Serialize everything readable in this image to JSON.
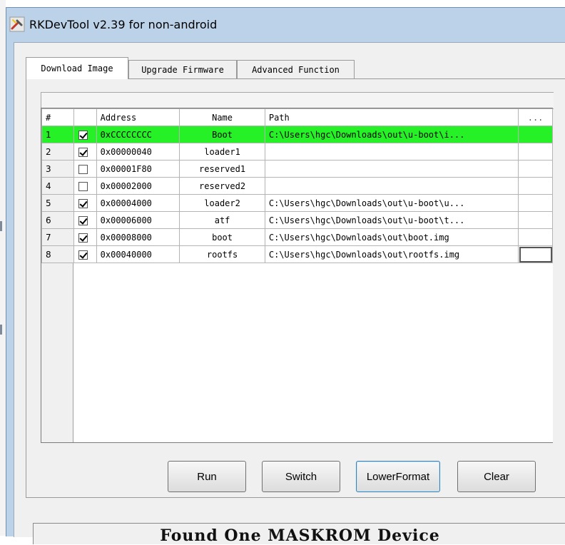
{
  "window": {
    "title": "RKDevTool v2.39 for non-android"
  },
  "tabs": [
    {
      "label": "Download Image",
      "active": true
    },
    {
      "label": "Upgrade Firmware",
      "active": false
    },
    {
      "label": "Advanced Function",
      "active": false
    }
  ],
  "table": {
    "headers": {
      "index": "#",
      "check": "",
      "address": "Address",
      "name": "Name",
      "path": "Path",
      "more": "..."
    },
    "rows": [
      {
        "index": "1",
        "checked": true,
        "address": "0xCCCCCCCC",
        "name": "Boot",
        "path": "C:\\Users\\hgc\\Downloads\\out\\u-boot\\i...",
        "selected": true
      },
      {
        "index": "2",
        "checked": true,
        "address": "0x00000040",
        "name": "loader1",
        "path": ""
      },
      {
        "index": "3",
        "checked": false,
        "address": "0x00001F80",
        "name": "reserved1",
        "path": ""
      },
      {
        "index": "4",
        "checked": false,
        "address": "0x00002000",
        "name": "reserved2",
        "path": ""
      },
      {
        "index": "5",
        "checked": true,
        "address": "0x00004000",
        "name": "loader2",
        "path": "C:\\Users\\hgc\\Downloads\\out\\u-boot\\u..."
      },
      {
        "index": "6",
        "checked": true,
        "address": "0x00006000",
        "name": "atf",
        "path": "C:\\Users\\hgc\\Downloads\\out\\u-boot\\t..."
      },
      {
        "index": "7",
        "checked": true,
        "address": "0x00008000",
        "name": "boot",
        "path": "C:\\Users\\hgc\\Downloads\\out\\boot.img"
      },
      {
        "index": "8",
        "checked": true,
        "address": "0x00040000",
        "name": "rootfs",
        "path": "C:\\Users\\hgc\\Downloads\\out\\rootfs.img"
      }
    ]
  },
  "buttons": {
    "run": "Run",
    "switch": "Switch",
    "lower_format": "LowerFormat",
    "clear": "Clear"
  },
  "status": {
    "text": "Found One MASKROM Device"
  },
  "colors": {
    "selected_row": "#26f026",
    "title_bar": "#bcd2e8"
  }
}
